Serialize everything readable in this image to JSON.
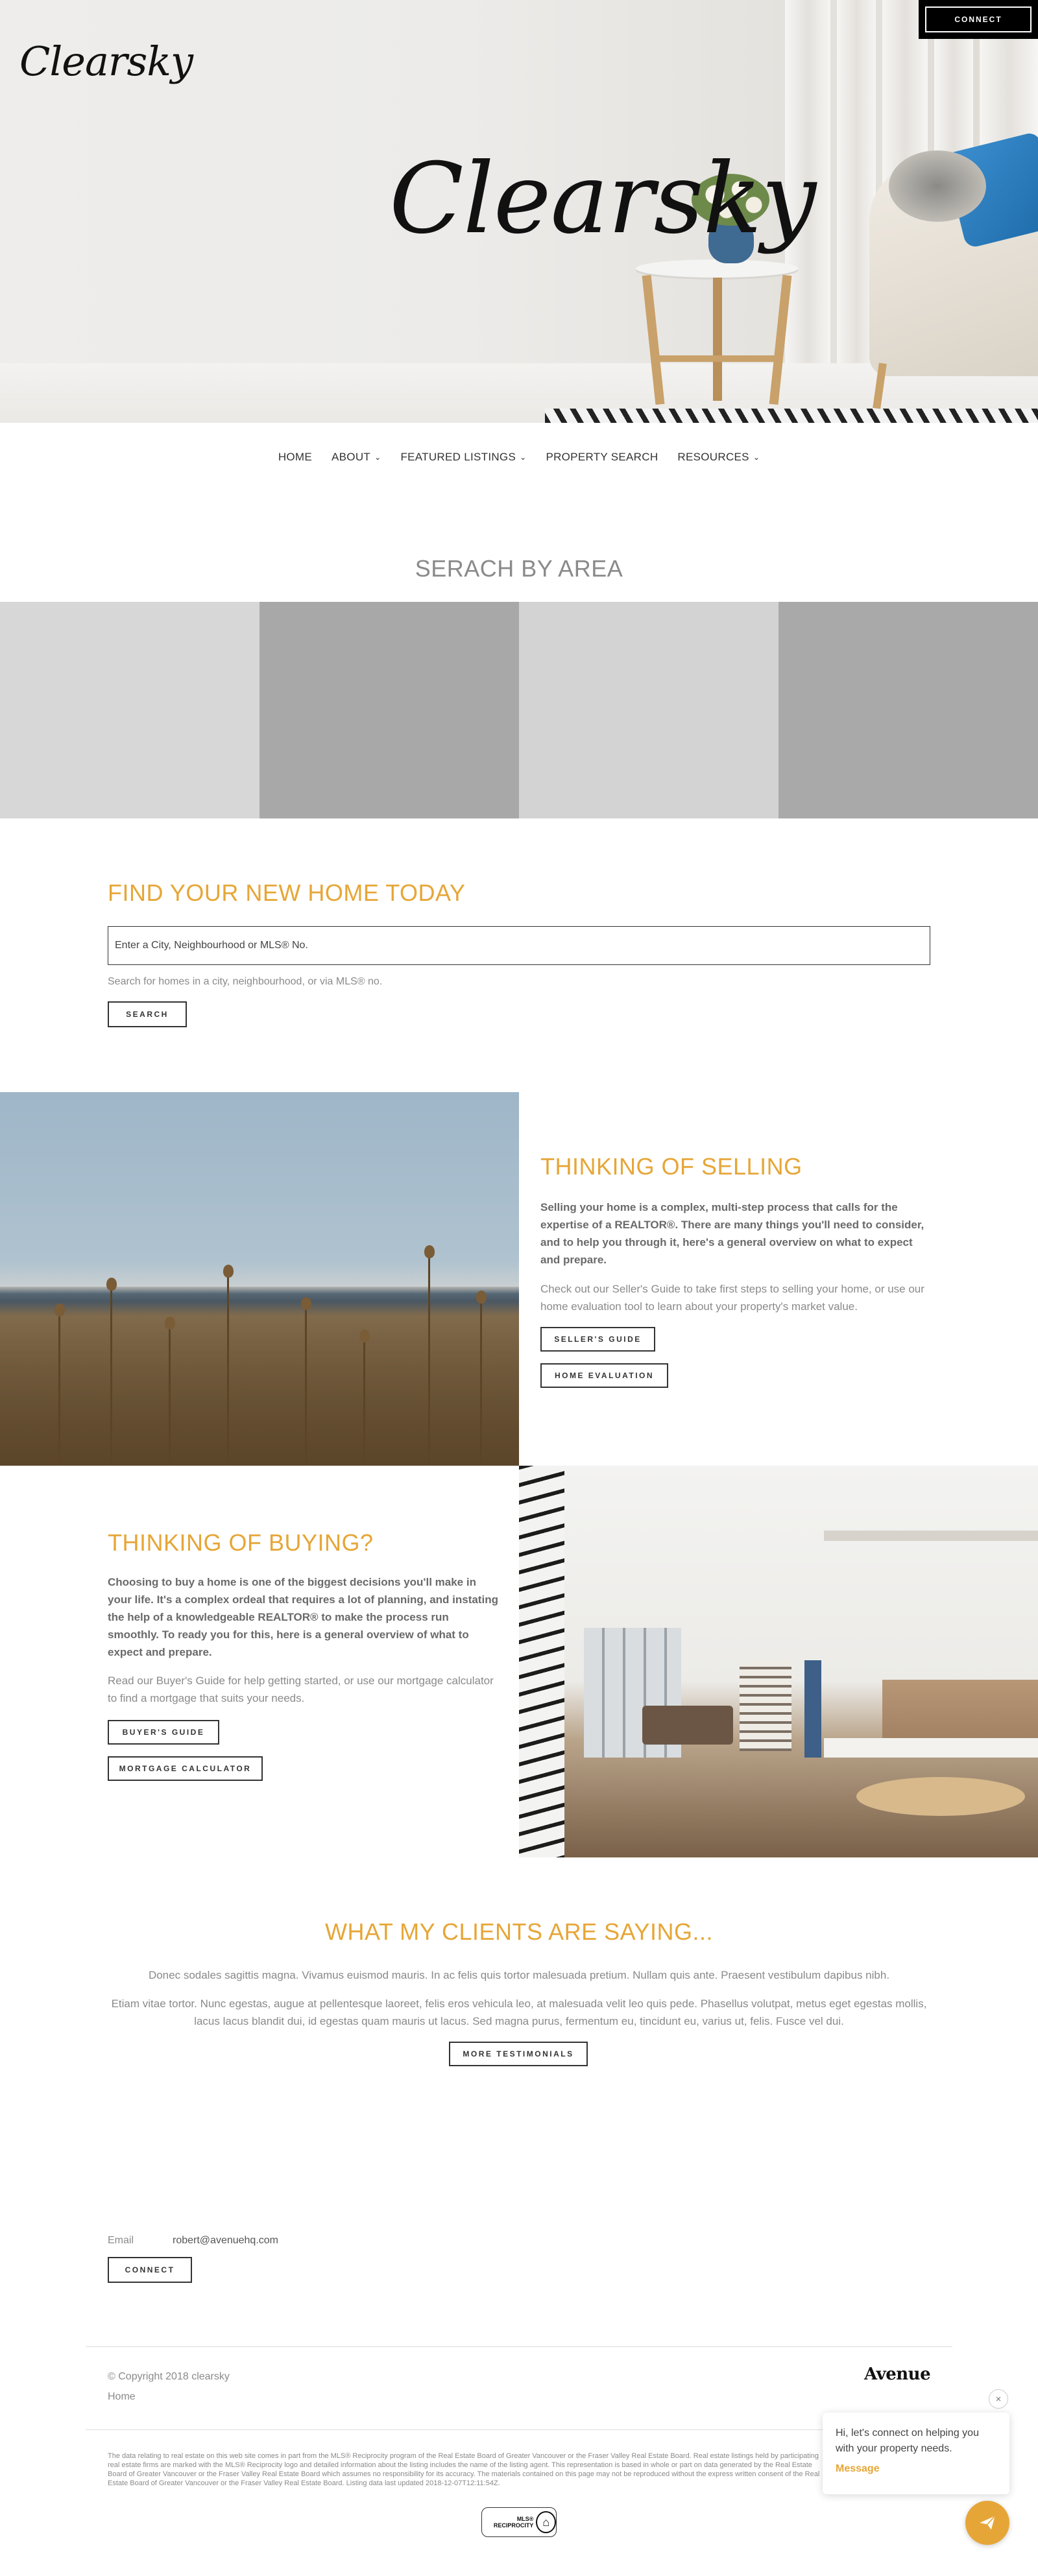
{
  "brand": {
    "logo_small": "Clearsky",
    "logo_big": "Clearsky"
  },
  "header": {
    "connect_label": "CONNECT"
  },
  "nav": {
    "items": [
      {
        "label": "HOME",
        "has_dropdown": false
      },
      {
        "label": "ABOUT",
        "has_dropdown": true
      },
      {
        "label": "FEATURED LISTINGS",
        "has_dropdown": true
      },
      {
        "label": "PROPERTY SEARCH",
        "has_dropdown": false
      },
      {
        "label": "RESOURCES",
        "has_dropdown": true
      }
    ]
  },
  "search_by_area": {
    "title": "SERACH BY AREA",
    "tile_colors": [
      "#d7d7d7",
      "#a8a8a8",
      "#d3d3d3",
      "#a9a9a9"
    ]
  },
  "find_home": {
    "title": "FIND YOUR NEW HOME TODAY",
    "input_placeholder": "Enter a City, Neighbourhood or MLS® No.",
    "help_text": "Search for homes in a city, neighbourhood, or via MLS® no.",
    "search_label": "SEARCH"
  },
  "selling": {
    "title": "THINKING OF SELLING",
    "bold_text": "Selling your home is a complex, multi-step process that calls for the expertise of a REALTOR®. There are many things you'll need to consider, and to help you through it, here's a general overview on what to expect and prepare.",
    "text": "Check out our Seller's Guide to take first steps to selling your home, or use our home evaluation tool to learn about your property's market value.",
    "seller_guide_label": "SELLER'S GUIDE",
    "home_eval_label": "HOME EVALUATION"
  },
  "buying": {
    "title": "THINKING OF BUYING?",
    "bold_text": "Choosing to buy a home is one of the biggest decisions you'll make in your life. It's a complex ordeal that requires a lot of planning, and instating the help of a knowledgeable REALTOR® to make the process run smoothly. To ready you for this, here is a general overview of what to expect and prepare.",
    "text": "Read our Buyer's Guide for help getting started, or use our mortgage calculator to find a mortgage that suits your needs.",
    "buyer_guide_label": "BUYER'S GUIDE",
    "mortgage_label": "MORTGAGE CALCULATOR"
  },
  "testimonials": {
    "title": "WHAT MY CLIENTS ARE SAYING...",
    "paragraph1": "Donec sodales sagittis magna. Vivamus euismod mauris. In ac felis quis tortor malesuada pretium. Nullam quis ante. Praesent vestibulum dapibus nibh.",
    "paragraph2": "Etiam vitae tortor. Nunc egestas, augue at pellentesque laoreet, felis eros vehicula leo, at malesuada velit leo quis pede. Phasellus volutpat, metus eget egestas mollis, lacus lacus blandit dui, id egestas quam mauris ut lacus. Sed magna purus, fermentum eu, tincidunt eu, varius ut, felis. Fusce vel dui.",
    "more_label": "MORE TESTIMONIALS"
  },
  "contact": {
    "email_label": "Email",
    "email_value": "robert@avenuehq.com",
    "connect_label": "CONNECT"
  },
  "footer": {
    "copyright": "© Copyright 2018 clearsky",
    "home_link": "Home",
    "partner_logo": "Avenue",
    "disclaimer": "The data relating to real estate on this web site comes in part from the MLS® Reciprocity program of the Real Estate Board of Greater Vancouver or the Fraser Valley Real Estate Board. Real estate listings held by participating real estate firms are marked with the MLS® Reciprocity logo and detailed information about the listing includes the name of the listing agent. This representation is based in whole or part on data generated by the Real Estate Board of Greater Vancouver or the Fraser Valley Real Estate Board which assumes no responsibility for its accuracy. The materials contained on this page may not be reproduced without the express written consent of the Real Estate Board of Greater Vancouver or the Fraser Valley Real Estate Board. Listing data last updated 2018-12-07T12:11:54Z.",
    "mls_badge_text": "MLS® RECIPROCITY"
  },
  "chat": {
    "text": "Hi, let's connect on helping you with your property needs.",
    "message_label": "Message",
    "close_glyph": "×"
  },
  "colors": {
    "accent": "#e6a637",
    "text_muted": "#8a8a8a",
    "dark": "#333333"
  },
  "icons": {
    "dropdown": "chevron-down-icon",
    "close": "close-icon",
    "send": "paper-plane-icon",
    "mls": "mls-house-icon"
  }
}
